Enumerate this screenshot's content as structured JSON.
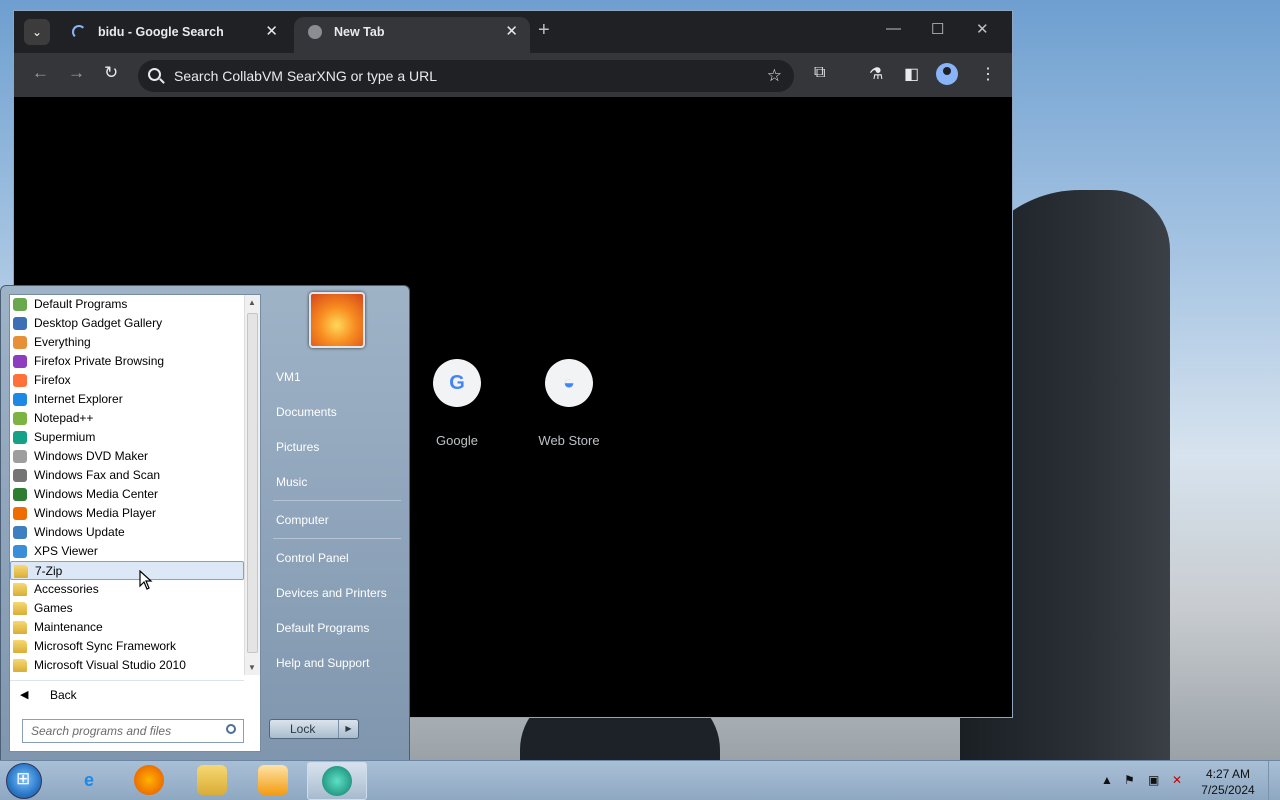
{
  "browser": {
    "tabs": [
      {
        "title": "bidu - Google Search",
        "state": "loading"
      },
      {
        "title": "New Tab",
        "state": "active"
      }
    ],
    "omnibox": {
      "placeholder": "Search CollabVM SearXNG or type a URL"
    },
    "shortcuts": [
      {
        "label": "Google",
        "glyph": "G",
        "color": "#4285f4"
      },
      {
        "label": "Web Store",
        "glyph": "◒",
        "color": "#4285f4"
      }
    ]
  },
  "start_menu": {
    "programs": [
      {
        "label": "Default Programs",
        "icon": "default-programs-icon",
        "color": "#6aa84f"
      },
      {
        "label": "Desktop Gadget Gallery",
        "icon": "gadget-icon",
        "color": "#3d6fb6"
      },
      {
        "label": "Everything",
        "icon": "everything-icon",
        "color": "#e69138"
      },
      {
        "label": "Firefox Private Browsing",
        "icon": "firefox-private-icon",
        "color": "#8e3dbf"
      },
      {
        "label": "Firefox",
        "icon": "firefox-icon",
        "color": "#ff7139"
      },
      {
        "label": "Internet Explorer",
        "icon": "ie-icon",
        "color": "#1e88e5"
      },
      {
        "label": "Notepad++",
        "icon": "notepadpp-icon",
        "color": "#7cb342"
      },
      {
        "label": "Supermium",
        "icon": "supermium-icon",
        "color": "#16a085"
      },
      {
        "label": "Windows DVD Maker",
        "icon": "dvd-maker-icon",
        "color": "#9e9e9e"
      },
      {
        "label": "Windows Fax and Scan",
        "icon": "fax-icon",
        "color": "#757575"
      },
      {
        "label": "Windows Media Center",
        "icon": "media-center-icon",
        "color": "#2e7d32"
      },
      {
        "label": "Windows Media Player",
        "icon": "media-player-icon",
        "color": "#ef6c00"
      },
      {
        "label": "Windows Update",
        "icon": "windows-update-icon",
        "color": "#3d7fc1"
      },
      {
        "label": "XPS Viewer",
        "icon": "xps-icon",
        "color": "#3b8fd8"
      },
      {
        "label": "7-Zip",
        "icon": "folder-icon",
        "color": "#e8c050",
        "selected": true
      },
      {
        "label": "Accessories",
        "icon": "folder-icon",
        "color": "#e8c050"
      },
      {
        "label": "Games",
        "icon": "folder-icon",
        "color": "#e8c050"
      },
      {
        "label": "Maintenance",
        "icon": "folder-icon",
        "color": "#e8c050"
      },
      {
        "label": "Microsoft Sync Framework",
        "icon": "folder-icon",
        "color": "#e8c050"
      },
      {
        "label": "Microsoft Visual Studio 2010",
        "icon": "folder-icon",
        "color": "#e8c050"
      }
    ],
    "back_label": "Back",
    "search_placeholder": "Search programs and files",
    "right_items": [
      "VM1",
      "Documents",
      "Pictures",
      "Music",
      "Computer",
      "Control Panel",
      "Devices and Printers",
      "Default Programs",
      "Help and Support"
    ],
    "lock_label": "Lock"
  },
  "taskbar": {
    "clock_time": "4:27 AM",
    "clock_date": "7/25/2024"
  }
}
